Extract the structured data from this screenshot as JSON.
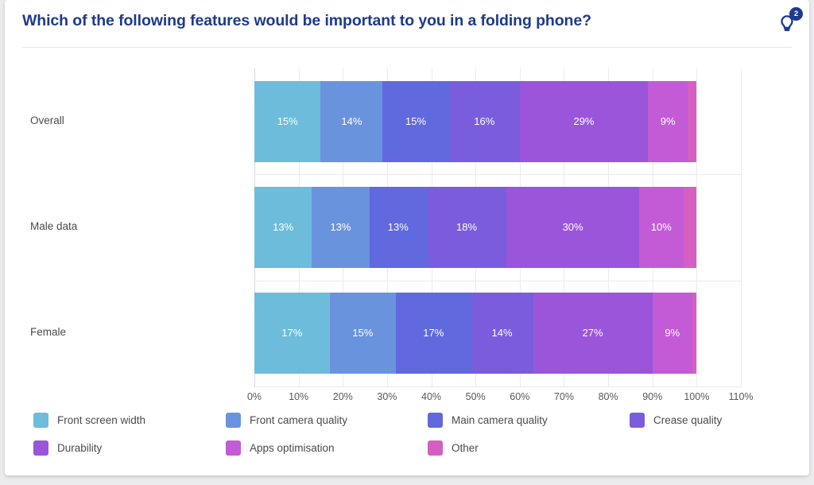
{
  "header": {
    "title": "Which of the following features would be important to you in a folding phone?",
    "icon": "lightbulb-icon",
    "badge_count": "2",
    "title_color": "#1e3a8c"
  },
  "chart_data": {
    "type": "bar",
    "orientation": "horizontal",
    "stacked": true,
    "title": "Which of the following features would be important to you in a folding phone?",
    "xlabel": "",
    "ylabel": "",
    "xlim": [
      0,
      110
    ],
    "grid": true,
    "legend_position": "bottom",
    "xticks": [
      "0%",
      "10%",
      "20%",
      "30%",
      "40%",
      "50%",
      "60%",
      "70%",
      "80%",
      "90%",
      "100%",
      "110%"
    ],
    "categories": [
      "Overall",
      "Male data",
      "Female"
    ],
    "series": [
      {
        "name": "Front screen width",
        "color": "#6dbcdb",
        "values": [
          15,
          13,
          17
        ],
        "labels": [
          "15%",
          "13%",
          "17%"
        ]
      },
      {
        "name": "Front camera quality",
        "color": "#6a93dd",
        "values": [
          14,
          13,
          15
        ],
        "labels": [
          "14%",
          "13%",
          "15%"
        ]
      },
      {
        "name": "Main camera quality",
        "color": "#6069de",
        "values": [
          15,
          13,
          17
        ],
        "labels": [
          "15%",
          "13%",
          "17%"
        ]
      },
      {
        "name": "Crease quality",
        "color": "#7a5ddc",
        "values": [
          16,
          18,
          14
        ],
        "labels": [
          "16%",
          "18%",
          "14%"
        ]
      },
      {
        "name": "Durability",
        "color": "#9a55db",
        "values": [
          29,
          30,
          27
        ],
        "labels": [
          "29%",
          "30%",
          "27%"
        ]
      },
      {
        "name": "Apps optimisation",
        "color": "#c35bd6",
        "values": [
          9,
          10,
          9
        ],
        "labels": [
          "9%",
          "10%",
          "9%"
        ]
      },
      {
        "name": "Other",
        "color": "#d55fc0",
        "values": [
          2,
          3,
          1
        ],
        "labels": [
          "",
          "",
          ""
        ]
      }
    ]
  }
}
